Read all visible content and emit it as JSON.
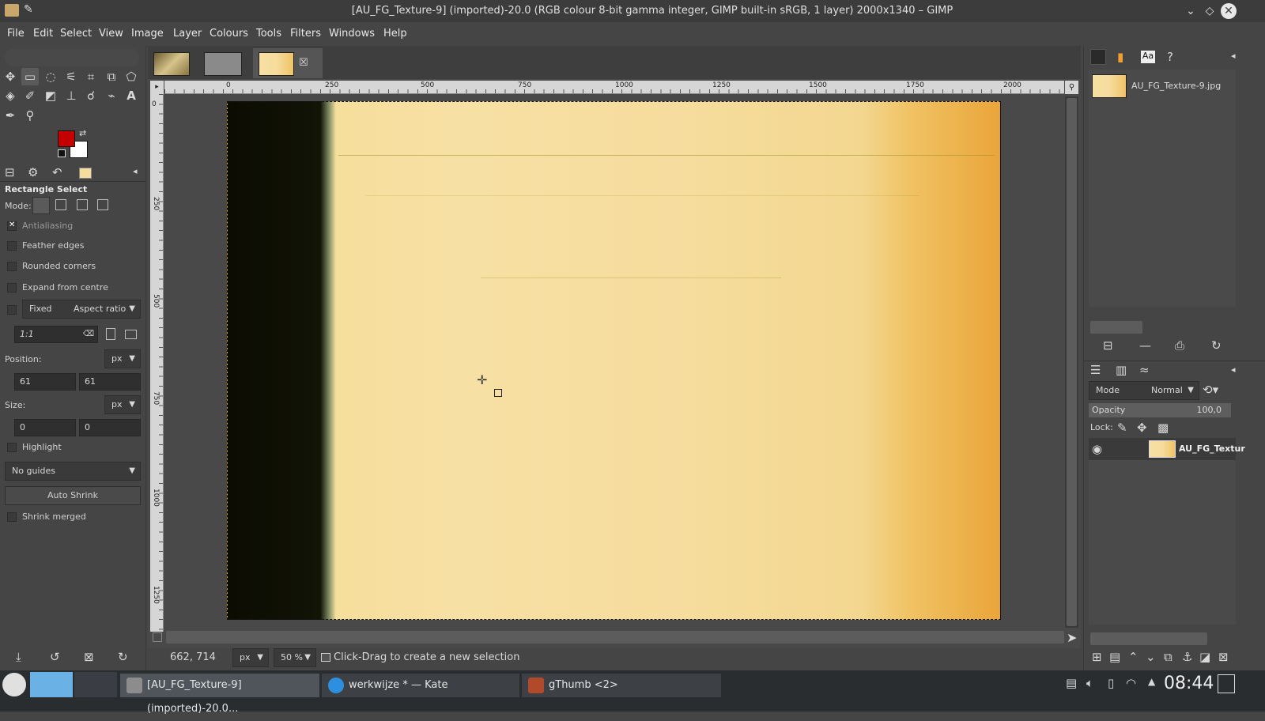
{
  "window": {
    "title": "[AU_FG_Texture-9] (imported)-20.0 (RGB colour 8-bit gamma integer, GIMP built-in sRGB, 1 layer) 2000x1340 – GIMP"
  },
  "menu": [
    "File",
    "Edit",
    "Select",
    "View",
    "Image",
    "Layer",
    "Colours",
    "Tools",
    "Filters",
    "Windows",
    "Help"
  ],
  "tool_options": {
    "title": "Rectangle Select",
    "mode_label": "Mode:",
    "antialiasing": "Antialiasing",
    "feather_edges": "Feather edges",
    "rounded_corners": "Rounded corners",
    "expand_from_centre": "Expand from centre",
    "fixed_label": "Fixed",
    "fixed_option": "Aspect ratio",
    "ratio_value": "1:1",
    "position_label": "Position:",
    "position_unit": "px",
    "pos_x": "61",
    "pos_y": "61",
    "size_label": "Size:",
    "size_unit": "px",
    "size_w": "0",
    "size_h": "0",
    "highlight": "Highlight",
    "guides": "No guides",
    "auto_shrink": "Auto Shrink",
    "shrink_merged": "Shrink merged"
  },
  "colors": {
    "foreground": "#c40000",
    "background": "#ffffff"
  },
  "ruler": {
    "h_labels": [
      "0",
      "250",
      "500",
      "750",
      "1000",
      "1250",
      "1500",
      "1750",
      "2000"
    ],
    "v_labels": [
      "0",
      "250",
      "500",
      "750",
      "1000",
      "1250"
    ]
  },
  "status": {
    "coords": "662, 714",
    "unit": "px",
    "zoom": "50 %",
    "message": "Click-Drag to create a new selection"
  },
  "images_panel": {
    "image_name": "AU_FG_Texture-9.jpg"
  },
  "layers_panel": {
    "mode_label": "Mode",
    "mode_value": "Normal",
    "opacity_label": "Opacity",
    "opacity_value": "100,0",
    "lock_label": "Lock:",
    "layer_name": "AU_FG_Textur"
  },
  "taskbar": {
    "tasks": [
      {
        "label": "[AU_FG_Texture-9] (imported)-20.0..."
      },
      {
        "label": "werkwijze * — Kate"
      },
      {
        "label": "gThumb <2>"
      }
    ],
    "clock": "08:44"
  }
}
